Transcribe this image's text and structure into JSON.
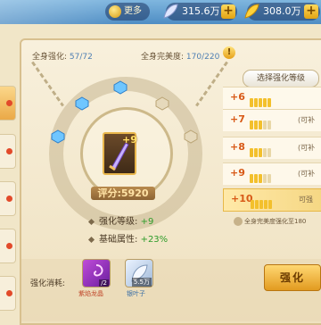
{
  "topbar": {
    "more_label": "更多",
    "currency_1": "315.6万",
    "currency_2": "308.0万"
  },
  "header": {
    "strengthen_label": "全身强化:",
    "strengthen_value": "57/72",
    "perfection_label": "全身完美度:",
    "perfection_value": "170/220"
  },
  "item": {
    "level_badge": "+9",
    "score": "评分:5920"
  },
  "stats": [
    {
      "label": "强化等级:",
      "value": "+9"
    },
    {
      "label": "基础属性:",
      "value": "+23%"
    }
  ],
  "select_button": "选择强化等级",
  "levels": [
    {
      "lvl": "+6",
      "note": ""
    },
    {
      "lvl": "+7",
      "note": "(可补"
    },
    {
      "lvl": "+8",
      "note": "(可补"
    },
    {
      "lvl": "+9",
      "note": "(可补"
    },
    {
      "lvl": "+10",
      "note": "可强"
    }
  ],
  "perfection_hint": "全身完美度强化至180",
  "cost": {
    "label": "强化消耗:",
    "items": [
      {
        "name": "紫焰龙晶",
        "count": "/2"
      },
      {
        "name": "银叶子",
        "count": "5.5万"
      }
    ]
  },
  "upgrade_button": "强化",
  "colors": {
    "accent": "#e29b20",
    "green": "#2e9c2a",
    "level_orange": "#d85a18"
  }
}
